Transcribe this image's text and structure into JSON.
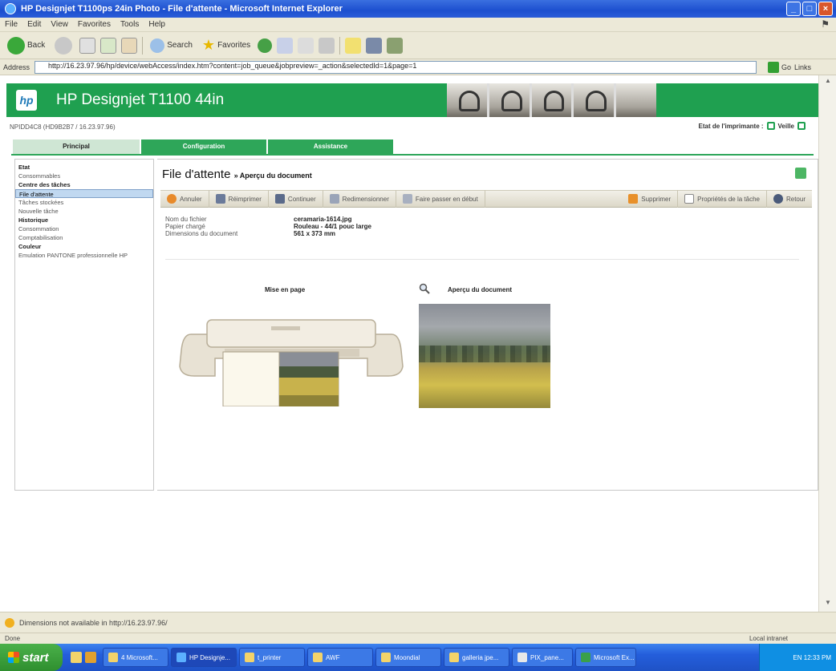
{
  "window": {
    "title": "HP Designjet T1100ps 24in Photo - File d'attente - Microsoft Internet Explorer",
    "minimize": "_",
    "maximize": "□",
    "close": "×"
  },
  "menu": [
    "File",
    "Edit",
    "View",
    "Favorites",
    "Tools",
    "Help"
  ],
  "toolbar": {
    "back": "Back",
    "search": "Search",
    "favorites": "Favorites"
  },
  "address": {
    "label": "Address",
    "url": "http://16.23.97.96/hp/device/webAccess/index.htm?content=job_queue&jobpreview=_action&selectedId=1&page=1",
    "go": "Go",
    "links": "Links"
  },
  "hp": {
    "logo": "hp",
    "product": "HP Designjet T1100 44in",
    "printer_id": "NPIDD4C8 (HD9B2B7 / 16.23.97.96)",
    "status_label": "Etat de l'imprimante :",
    "status_value": "Veille"
  },
  "tabs": [
    "Principal",
    "Configuration",
    "Assistance"
  ],
  "sidebar": [
    {
      "label": "Etat",
      "type": "head"
    },
    {
      "label": "Consommables",
      "type": "item"
    },
    {
      "label": "Centre des tâches",
      "type": "head"
    },
    {
      "label": "File d'attente",
      "type": "sel"
    },
    {
      "label": "Tâches stockées",
      "type": "item"
    },
    {
      "label": "Nouvelle tâche",
      "type": "item"
    },
    {
      "label": "Historique",
      "type": "head"
    },
    {
      "label": "Consommation",
      "type": "item"
    },
    {
      "label": "Comptabilisation",
      "type": "item"
    },
    {
      "label": "Couleur",
      "type": "head"
    },
    {
      "label": "Emulation PANTONE professionnelle HP",
      "type": "item"
    }
  ],
  "main": {
    "title": "File d'attente",
    "subtitle": "» Aperçu du document",
    "actions": [
      "Annuler",
      "Réimprimer",
      "Continuer",
      "Redimensionner",
      "Faire passer en début"
    ],
    "actions_right": [
      "Supprimer",
      "Propriétés de la tâche",
      "Retour"
    ],
    "info": [
      {
        "label": "Nom du fichier",
        "value": "ceramaria-1614.jpg"
      },
      {
        "label": "Papier chargé",
        "value": "Rouleau - 44/1 pouc large"
      },
      {
        "label": "Dimensions du document",
        "value": "561 x 373 mm"
      }
    ],
    "layout_label": "Mise en page",
    "preview_label": "Aperçu du document"
  },
  "statusbar": {
    "text": "Dimensions not available in http://16.23.97.96/",
    "bottom_left": "Done",
    "bottom_right": "Local intranet"
  },
  "taskbar": {
    "start": "start",
    "tasks": [
      "4 Microsoft...",
      "HP Designje...",
      "t_printer",
      "AWF",
      "Moondial",
      "galleria jpe...",
      "PIX_pane...",
      "Microsoft Ex..."
    ],
    "tray": "EN   12:33 PM"
  }
}
